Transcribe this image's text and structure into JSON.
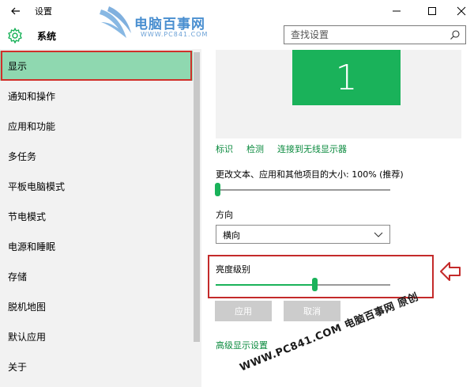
{
  "window": {
    "title": "设置",
    "section_title": "系统"
  },
  "logo": {
    "name": "电脑百事网",
    "url": "WWW.PC841.COM"
  },
  "search": {
    "placeholder": "查找设置"
  },
  "sidebar": {
    "items": [
      {
        "label": "显示",
        "active": true
      },
      {
        "label": "通知和操作",
        "active": false
      },
      {
        "label": "应用和功能",
        "active": false
      },
      {
        "label": "多任务",
        "active": false
      },
      {
        "label": "平板电脑模式",
        "active": false
      },
      {
        "label": "节电模式",
        "active": false
      },
      {
        "label": "电源和睡眠",
        "active": false
      },
      {
        "label": "存储",
        "active": false
      },
      {
        "label": "脱机地图",
        "active": false
      },
      {
        "label": "默认应用",
        "active": false
      },
      {
        "label": "关于",
        "active": false
      }
    ]
  },
  "display": {
    "monitor_number": "1",
    "links": [
      "标识",
      "检测",
      "连接到无线显示器"
    ],
    "scale_label": "更改文本、应用和其他项目的大小: 100% (推荐)",
    "scale_slider_value": 0,
    "orientation_label": "方向",
    "orientation_value": "横向",
    "brightness_label": "亮度级别",
    "brightness_value": 0.58,
    "apply_label": "应用",
    "cancel_label": "取消",
    "advanced_link": "高级显示设置"
  },
  "watermark": "WWW.PC841.COM 电脑百事网 原创",
  "colors": {
    "accent": "#1ab25a",
    "active_nav": "#8fd8b0",
    "highlight": "#c42a2a",
    "link": "#0a8a3e"
  },
  "icons": {
    "back": "back-arrow-icon",
    "gear": "gear-icon",
    "search": "search-icon",
    "minimize": "minimize-icon",
    "maximize": "maximize-icon",
    "close": "close-icon",
    "chevron": "chevron-down-icon",
    "pointer": "left-arrow-icon"
  }
}
